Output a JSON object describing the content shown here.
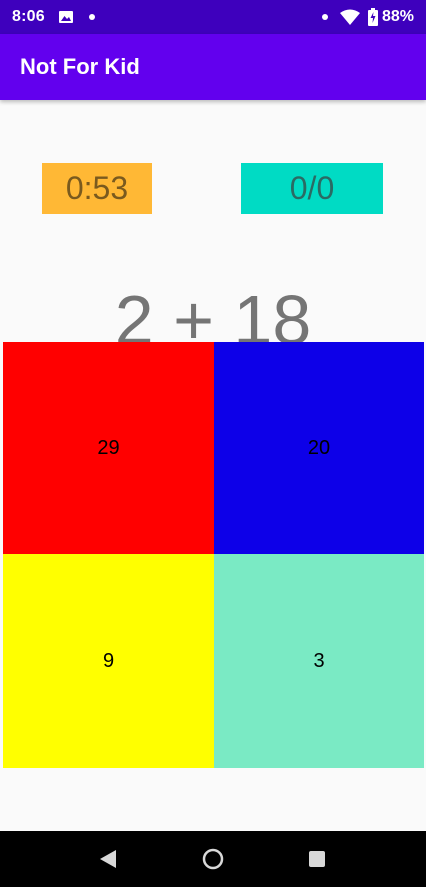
{
  "status_bar": {
    "time": "8:06",
    "battery": "88%",
    "background": "#3e00bd",
    "icons": [
      "photo-icon",
      "notification-dot-icon",
      "notification-dot-icon",
      "wifi-icon",
      "battery-charging-icon"
    ]
  },
  "app_bar": {
    "title": "Not For Kid",
    "background": "#6200ee"
  },
  "game": {
    "timer": "0:53",
    "score": "0/0",
    "question": "2 + 18",
    "answers": [
      "29",
      "20",
      "9",
      "3"
    ],
    "colors": {
      "timer_bg": "#ffb835",
      "score_bg": "#00dbc4",
      "answer_1_bg": "#ff0000",
      "answer_2_bg": "#0d00e8",
      "answer_3_bg": "#ffff00",
      "answer_4_bg": "#7aeac4"
    }
  },
  "nav_bar": {
    "icons": [
      "back-icon",
      "home-icon",
      "recents-icon"
    ]
  }
}
